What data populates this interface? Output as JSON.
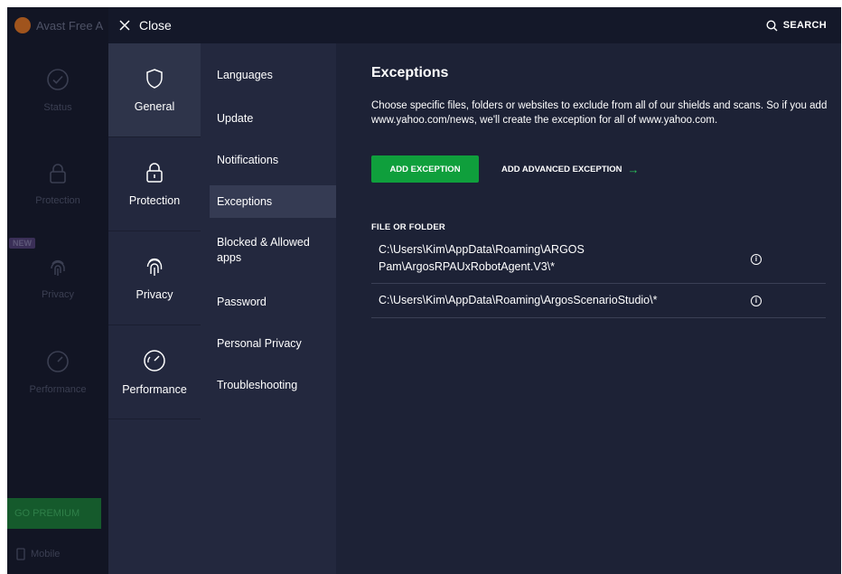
{
  "background": {
    "app_title": "Avast Free A",
    "nav": [
      {
        "label": "Status",
        "icon": "check-circle-icon"
      },
      {
        "label": "Protection",
        "icon": "lock-icon"
      },
      {
        "label": "Privacy",
        "icon": "fingerprint-icon"
      },
      {
        "label": "Performance",
        "icon": "speedometer-icon"
      }
    ],
    "new_badge": "NEW",
    "premium_label": "GO PREMIUM",
    "mobile_label": "Mobile"
  },
  "topbar": {
    "close_label": "Close",
    "search_label": "SEARCH"
  },
  "categories": [
    {
      "label": "General",
      "icon": "shield-icon",
      "active": true
    },
    {
      "label": "Protection",
      "icon": "lock-icon",
      "active": false
    },
    {
      "label": "Privacy",
      "icon": "fingerprint-icon",
      "active": false
    },
    {
      "label": "Performance",
      "icon": "speedometer-icon",
      "active": false
    }
  ],
  "submenu": [
    {
      "label": "Languages"
    },
    {
      "label": "Update"
    },
    {
      "label": "Notifications"
    },
    {
      "label": "Exceptions",
      "active": true
    },
    {
      "label": "Blocked & Allowed apps"
    },
    {
      "label": "Password"
    },
    {
      "label": "Personal Privacy"
    },
    {
      "label": "Troubleshooting"
    }
  ],
  "exceptions": {
    "title": "Exceptions",
    "description": "Choose specific files, folders or websites to exclude from all of our shields and scans. So if you add www.yahoo.com/news, we'll create the exception for all of www.yahoo.com.",
    "add_button": "ADD EXCEPTION",
    "advanced_button": "ADD ADVANCED EXCEPTION",
    "section_label": "FILE OR FOLDER",
    "items": [
      {
        "path": "C:\\Users\\Kim\\AppData\\Roaming\\ARGOS Pam\\ArgosRPAUxRobotAgent.V3\\*"
      },
      {
        "path": "C:\\Users\\Kim\\AppData\\Roaming\\ArgosScenarioStudio\\*"
      }
    ]
  },
  "colors": {
    "accent_green": "#0f9f3c",
    "background": "#1d2236",
    "panel": "#23283e"
  }
}
